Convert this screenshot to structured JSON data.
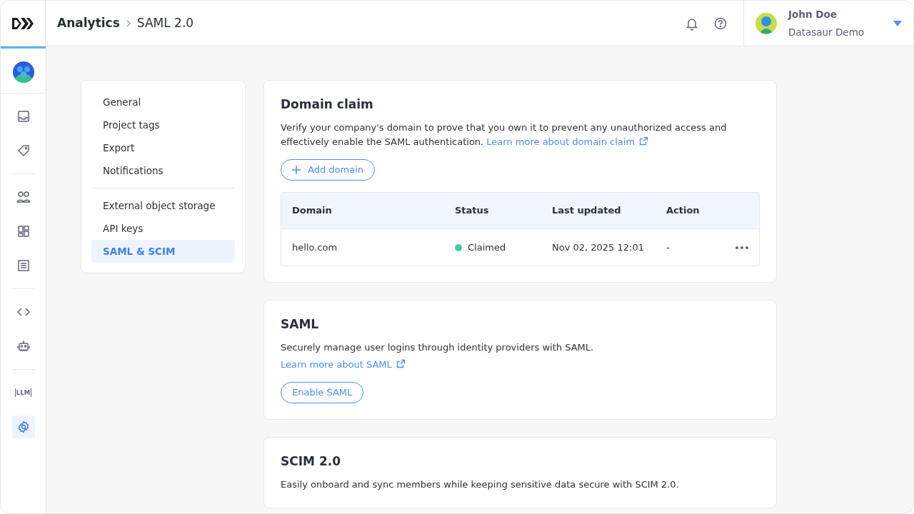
{
  "header": {
    "breadcrumb": [
      {
        "label": "Analytics"
      },
      {
        "label": "SAML 2.0"
      }
    ],
    "user": {
      "name": "John Doe",
      "workspace": "Datasaur Demo"
    }
  },
  "rail": {
    "groups": [
      [
        {
          "kind": "inbox",
          "selected": false
        },
        {
          "kind": "tag",
          "selected": false
        }
      ],
      [
        {
          "kind": "people",
          "selected": false
        },
        {
          "kind": "grid",
          "selected": false
        },
        {
          "kind": "document",
          "selected": false
        }
      ],
      [
        {
          "kind": "code",
          "selected": false
        },
        {
          "kind": "robot",
          "selected": false
        }
      ],
      [
        {
          "kind": "llm",
          "text": "LLM",
          "selected": false
        },
        {
          "kind": "gear",
          "selected": true
        }
      ]
    ]
  },
  "settings_nav": {
    "groups": [
      [
        {
          "label": "General",
          "selected": false
        },
        {
          "label": "Project tags",
          "selected": false
        },
        {
          "label": "Export",
          "selected": false
        },
        {
          "label": "Notifications",
          "selected": false
        }
      ],
      [
        {
          "label": "External object storage",
          "selected": false
        },
        {
          "label": "API keys",
          "selected": false
        },
        {
          "label": "SAML & SCIM",
          "selected": true
        }
      ]
    ]
  },
  "cards": [
    {
      "title": "Domain claim",
      "description": "Verify your company's domain to prove that you own it to prevent any unauthorized access and effectively enable the SAML authentication.",
      "link": "Learn more about domain claim",
      "link_block": false,
      "button": {
        "label": "Add domain",
        "kind": "add"
      },
      "table": {
        "columns": [
          "Domain",
          "Status",
          "Last updated",
          "Action"
        ],
        "rows": [
          {
            "domain": "hello.com",
            "status": "Claimed",
            "color": "#3ecf9e",
            "last_updated": "Nov 02, 2025 12:01",
            "action": "-"
          }
        ]
      }
    },
    {
      "title": "SAML",
      "description": "Securely manage user logins through identity providers with SAML.",
      "link": "Learn more about SAML",
      "link_block": true,
      "button": {
        "label": "Enable SAML"
      }
    },
    {
      "title": "SCIM 2.0",
      "description": "Easily onboard and sync members while keeping sensitive data secure with SCIM 2.0."
    }
  ]
}
